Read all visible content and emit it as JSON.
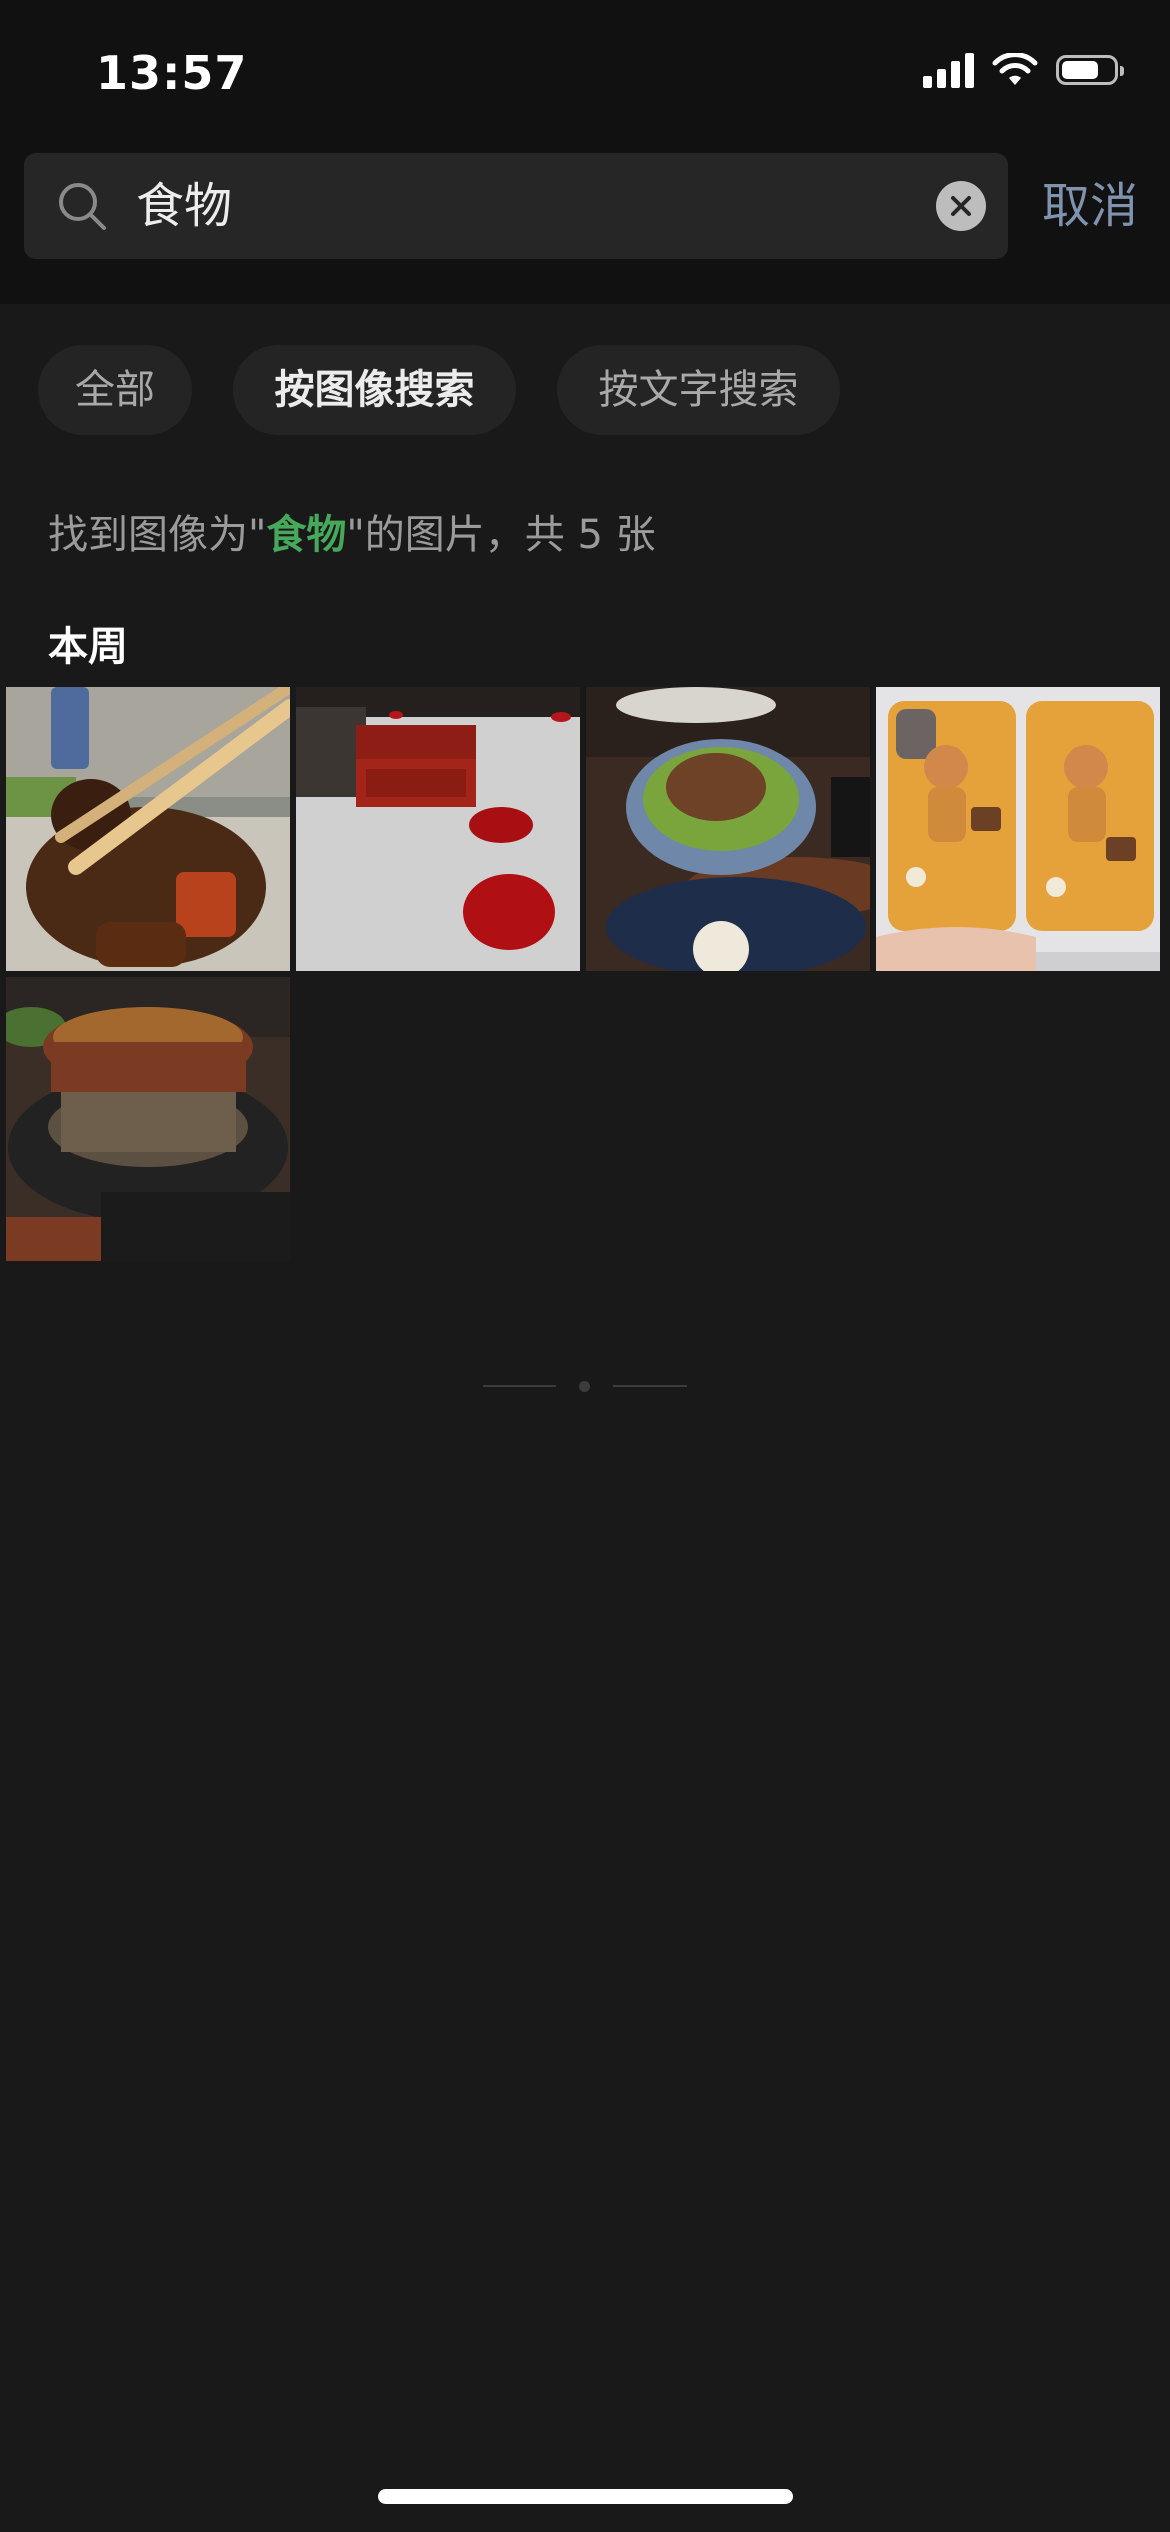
{
  "status_bar": {
    "time": "13:57",
    "battery_level": 0.65
  },
  "search": {
    "query": "食物",
    "cancel_label": "取消"
  },
  "filters": [
    {
      "label": "全部",
      "active": false
    },
    {
      "label": "按图像搜索",
      "active": true
    },
    {
      "label": "按文字搜索",
      "active": false
    }
  ],
  "result": {
    "prefix": "找到图像为\"",
    "keyword": "食物",
    "suffix": "\"的图片，共 5 张"
  },
  "section": {
    "title": "本周"
  },
  "colors": {
    "accent_green": "#46a85a",
    "cancel_blue": "#7f93ae",
    "background": "#191919"
  }
}
